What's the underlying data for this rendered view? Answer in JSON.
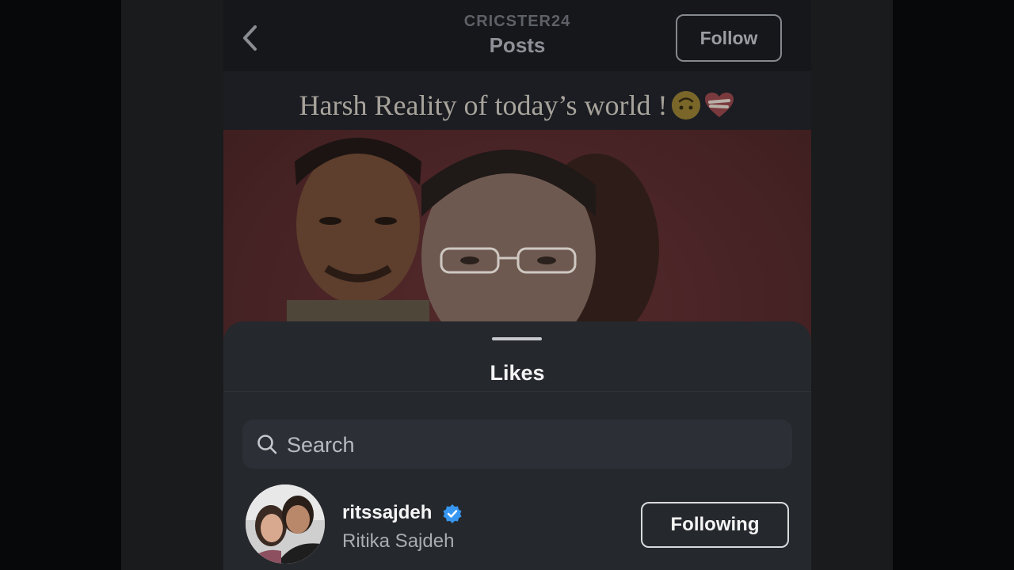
{
  "header": {
    "account": "CRICSTER24",
    "title": "Posts",
    "follow_label": "Follow"
  },
  "post": {
    "caption": "Harsh Reality of today’s world !",
    "emojis": [
      "upside-down-face-icon",
      "mending-heart-icon"
    ]
  },
  "likes_sheet": {
    "title": "Likes",
    "search": {
      "placeholder": "Search",
      "value": ""
    },
    "users": [
      {
        "username": "ritssajdeh",
        "full_name": "Ritika Sajdeh",
        "verified": true,
        "button_label": "Following"
      }
    ]
  },
  "colors": {
    "verified_badge": "#3797f0",
    "sheet_background": "#25282d",
    "header_background": "#15171a"
  }
}
